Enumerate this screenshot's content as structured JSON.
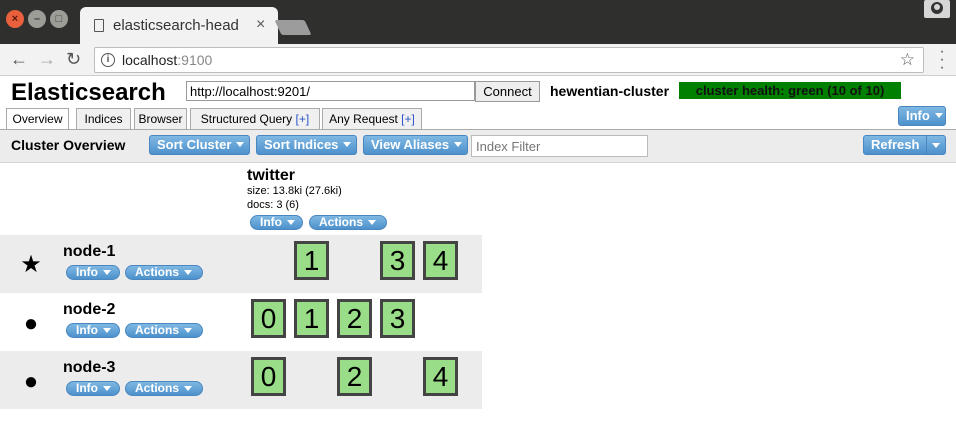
{
  "browser": {
    "tab_title": "elasticsearch-head",
    "tab_close": "×",
    "url_host": "localhost",
    "url_port": ":9100"
  },
  "app": {
    "title": "Elasticsearch",
    "connect_url": "http://localhost:9201/",
    "connect_label": "Connect",
    "cluster_name": "hewentian-cluster",
    "cluster_health": "cluster health: green (10 of 10)",
    "health_color": "#008000",
    "tabs": [
      {
        "label": "Overview",
        "plus": ""
      },
      {
        "label": "Indices",
        "plus": ""
      },
      {
        "label": "Browser",
        "plus": ""
      },
      {
        "label": "Structured Query ",
        "plus": "[+]"
      },
      {
        "label": "Any Request ",
        "plus": "[+]"
      }
    ],
    "info_label": "Info"
  },
  "overview": {
    "title": "Cluster Overview",
    "sort_cluster": "Sort Cluster",
    "sort_indices": "Sort Indices",
    "view_aliases": "View Aliases",
    "filter_placeholder": "Index Filter",
    "refresh_label": "Refresh"
  },
  "index": {
    "name": "twitter",
    "size": "size: 13.8ki (27.6ki)",
    "docs": "docs: 3 (6)",
    "info_label": "Info",
    "actions_label": "Actions"
  },
  "nodes": [
    {
      "name": "node-1",
      "icon": "★",
      "info_label": "Info",
      "actions_label": "Actions",
      "shards": [
        "1",
        "3",
        "4"
      ]
    },
    {
      "name": "node-2",
      "icon": "●",
      "info_label": "Info",
      "actions_label": "Actions",
      "shards": [
        "0",
        "1",
        "2",
        "3"
      ]
    },
    {
      "name": "node-3",
      "icon": "●",
      "info_label": "Info",
      "actions_label": "Actions",
      "shards": [
        "0",
        "2",
        "4"
      ]
    }
  ],
  "colors": {
    "accent": "#4d91cc",
    "shard_fill": "#99dd88",
    "shard_border": "#444444"
  }
}
